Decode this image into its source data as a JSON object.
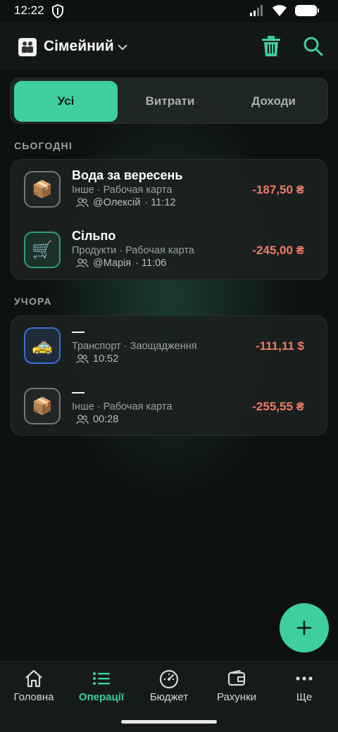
{
  "status": {
    "time": "12:22"
  },
  "header": {
    "title": "Сімейний"
  },
  "tabs": [
    {
      "label": "Усі",
      "active": true
    },
    {
      "label": "Витрати",
      "active": false
    },
    {
      "label": "Доходи",
      "active": false
    }
  ],
  "sections": [
    {
      "title": "СЬОГОДНІ",
      "transactions": [
        {
          "icon": "package-icon",
          "emoji": "📦",
          "title": "Вода за вересень",
          "category": "Інше · Рабочая карта",
          "user": "@Олексій",
          "time": "· 11:12",
          "amount": "-187,50 ₴"
        },
        {
          "icon": "shopping-cart-icon",
          "emoji": "🛒",
          "title": "Сільпо",
          "category": "Продукти · Рабочая карта",
          "user": "@Марія",
          "time": "· 11:06",
          "amount": "-245,00 ₴"
        }
      ]
    },
    {
      "title": "УЧОРА",
      "transactions": [
        {
          "icon": "taxi-icon",
          "emoji": "🚕",
          "title": "—",
          "category": "Транспорт · Заощадження",
          "user": "",
          "time": "10:52",
          "amount": "-111,11 $"
        },
        {
          "icon": "package-icon",
          "emoji": "📦",
          "title": "—",
          "category": "Інше · Рабочая карта",
          "user": "",
          "time": "00:28",
          "amount": "-255,55 ₴"
        }
      ]
    }
  ],
  "nav": [
    {
      "label": "Головна",
      "icon": "home-icon",
      "active": false
    },
    {
      "label": "Операції",
      "icon": "list-icon",
      "active": true
    },
    {
      "label": "Бюджет",
      "icon": "gauge-icon",
      "active": false
    },
    {
      "label": "Рахунки",
      "icon": "wallet-icon",
      "active": false
    },
    {
      "label": "Ще",
      "icon": "more-icon",
      "active": false
    }
  ],
  "colors": {
    "accent": "#3fcf9f",
    "negative": "#ef7a68",
    "background": "#0d1110"
  }
}
